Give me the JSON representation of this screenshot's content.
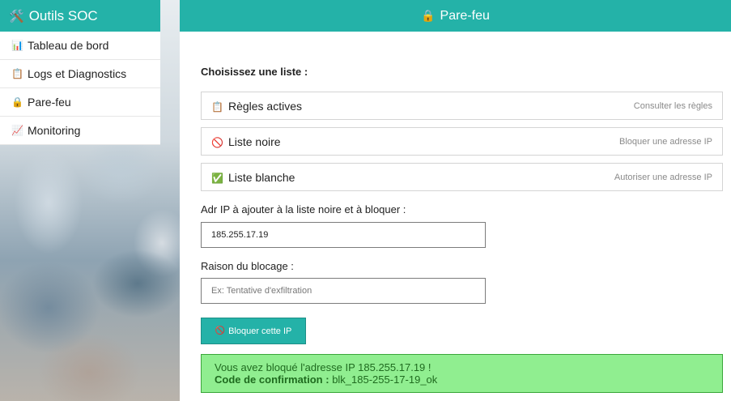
{
  "sidebar": {
    "title": "Outils SOC",
    "title_icon": "🛠️",
    "items": [
      {
        "icon": "📊",
        "label": "Tableau de bord"
      },
      {
        "icon": "📋",
        "label": "Logs et Diagnostics"
      },
      {
        "icon": "🔒",
        "label": "Pare-feu"
      },
      {
        "icon": "📈",
        "label": "Monitoring"
      }
    ]
  },
  "header": {
    "icon": "🔒",
    "title": "Pare-feu"
  },
  "main": {
    "choose_label": "Choisissez une liste :",
    "lists": [
      {
        "icon": "📋",
        "name": "Règles actives",
        "description": "Consulter les règles"
      },
      {
        "icon": "🚫",
        "name": "Liste noire",
        "description": "Bloquer une adresse IP"
      },
      {
        "icon": "✅",
        "name": "Liste blanche",
        "description": "Autoriser une adresse IP"
      }
    ],
    "ip_label": "Adr IP à ajouter à la liste noire et à bloquer :",
    "ip_value": "185.255.17.19",
    "reason_label": "Raison du blocage :",
    "reason_value": "",
    "reason_placeholder": "Ex: Tentative d'exfiltration",
    "block_button_icon": "🚫",
    "block_button_label": "Bloquer cette IP",
    "alert_line1": "Vous avez bloqué l'adresse IP 185.255.17.19 !",
    "alert_code_label": "Code de confirmation :",
    "alert_code_value": "blk_185-255-17-19_ok"
  },
  "colors": {
    "accent": "#24b2a8",
    "success_bg": "#90ee90",
    "success_text": "#1f6b1f"
  }
}
